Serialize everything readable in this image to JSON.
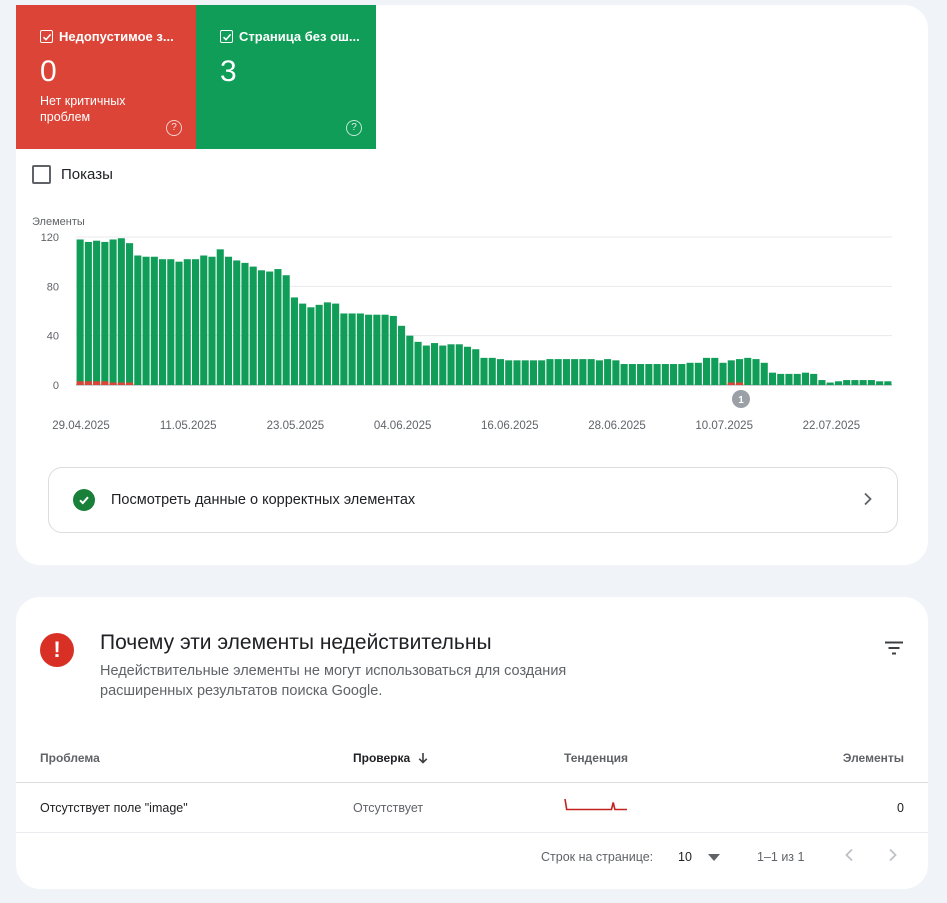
{
  "tiles": [
    {
      "title": "Недопустимое з...",
      "count": "0",
      "desc": "Нет критичных проблем",
      "color": "#db4437"
    },
    {
      "title": "Страница без ош...",
      "count": "3",
      "desc": "",
      "color": "#0f9d58"
    }
  ],
  "impressions_label": "Показы",
  "chart_data": {
    "type": "bar",
    "ylabel": "Элементы",
    "ylim": [
      0,
      120
    ],
    "yticks": [
      "0",
      "40",
      "80",
      "120"
    ],
    "xticks": [
      "29.04.2025",
      "11.05.2025",
      "23.05.2025",
      "04.06.2025",
      "16.06.2025",
      "28.06.2025",
      "10.07.2025",
      "22.07.2025"
    ],
    "annotation": "1",
    "series": [
      {
        "name": "Страница без ошибок",
        "color": "#0f9d58",
        "values": [
          118,
          116,
          117,
          116,
          118,
          119,
          115,
          105,
          104,
          104,
          102,
          102,
          100,
          102,
          102,
          105,
          104,
          110,
          104,
          101,
          99,
          96,
          93,
          92,
          94,
          89,
          71,
          66,
          63,
          65,
          67,
          66,
          58,
          58,
          58,
          57,
          57,
          57,
          56,
          48,
          40,
          35,
          32,
          34,
          32,
          33,
          33,
          31,
          29,
          22,
          22,
          21,
          20,
          20,
          20,
          20,
          20,
          21,
          21,
          21,
          21,
          21,
          21,
          20,
          21,
          20,
          17,
          17,
          17,
          17,
          17,
          17,
          17,
          17,
          18,
          18,
          22,
          22,
          18,
          20,
          21,
          22,
          21,
          18,
          10,
          9,
          9,
          9,
          10,
          9,
          4,
          2,
          3,
          4,
          4,
          4,
          4,
          3,
          3
        ]
      },
      {
        "name": "Недопустимое значение",
        "color": "#db4437",
        "values": [
          3,
          3,
          3,
          3,
          2,
          2,
          2,
          0,
          0,
          0,
          0,
          0,
          0,
          0,
          0,
          0,
          0,
          0,
          0,
          0,
          0,
          0,
          0,
          0,
          0,
          0,
          0,
          0,
          0,
          0,
          0,
          0,
          0,
          0,
          0,
          0,
          0,
          0,
          0,
          0,
          0,
          0,
          0,
          0,
          0,
          0,
          0,
          0,
          0,
          0,
          0,
          0,
          0,
          0,
          0,
          0,
          0,
          0,
          0,
          0,
          0,
          0,
          0,
          0,
          0,
          0,
          0,
          0,
          0,
          0,
          0,
          0,
          0,
          0,
          0,
          0,
          0,
          0,
          0,
          2,
          2,
          0,
          0,
          0,
          0,
          0,
          0,
          0,
          0,
          0,
          0,
          0,
          0,
          0,
          0,
          0,
          0,
          0,
          0
        ]
      }
    ]
  },
  "valid_link_label": "Посмотреть данные о корректных элементах",
  "section": {
    "title": "Почему эти элементы недействительны",
    "desc": "Недействительные элементы не могут использоваться для создания расширенных результатов поиска Google."
  },
  "table": {
    "headers": [
      "Проблема",
      "Проверка",
      "Тенденция",
      "Элементы"
    ],
    "rows": [
      {
        "issue": "Отсутствует поле \"image\"",
        "check": "Отсутствует",
        "trend": [
          12,
          3,
          3,
          3,
          3,
          3,
          3,
          3,
          3,
          3,
          3,
          3,
          3,
          3,
          3,
          3,
          3,
          3,
          3,
          3,
          3,
          3,
          3,
          3,
          3,
          3,
          3,
          3,
          9,
          3,
          3,
          3,
          3,
          3,
          3,
          3,
          3
        ],
        "count": "0"
      }
    ]
  },
  "pager": {
    "rows_label": "Строк на странице:",
    "rows_value": "10",
    "range": "1–1 из 1"
  },
  "colors": {
    "accent_red": "#d93025",
    "valid_green": "#188038",
    "trend_red": "#c5221f"
  }
}
